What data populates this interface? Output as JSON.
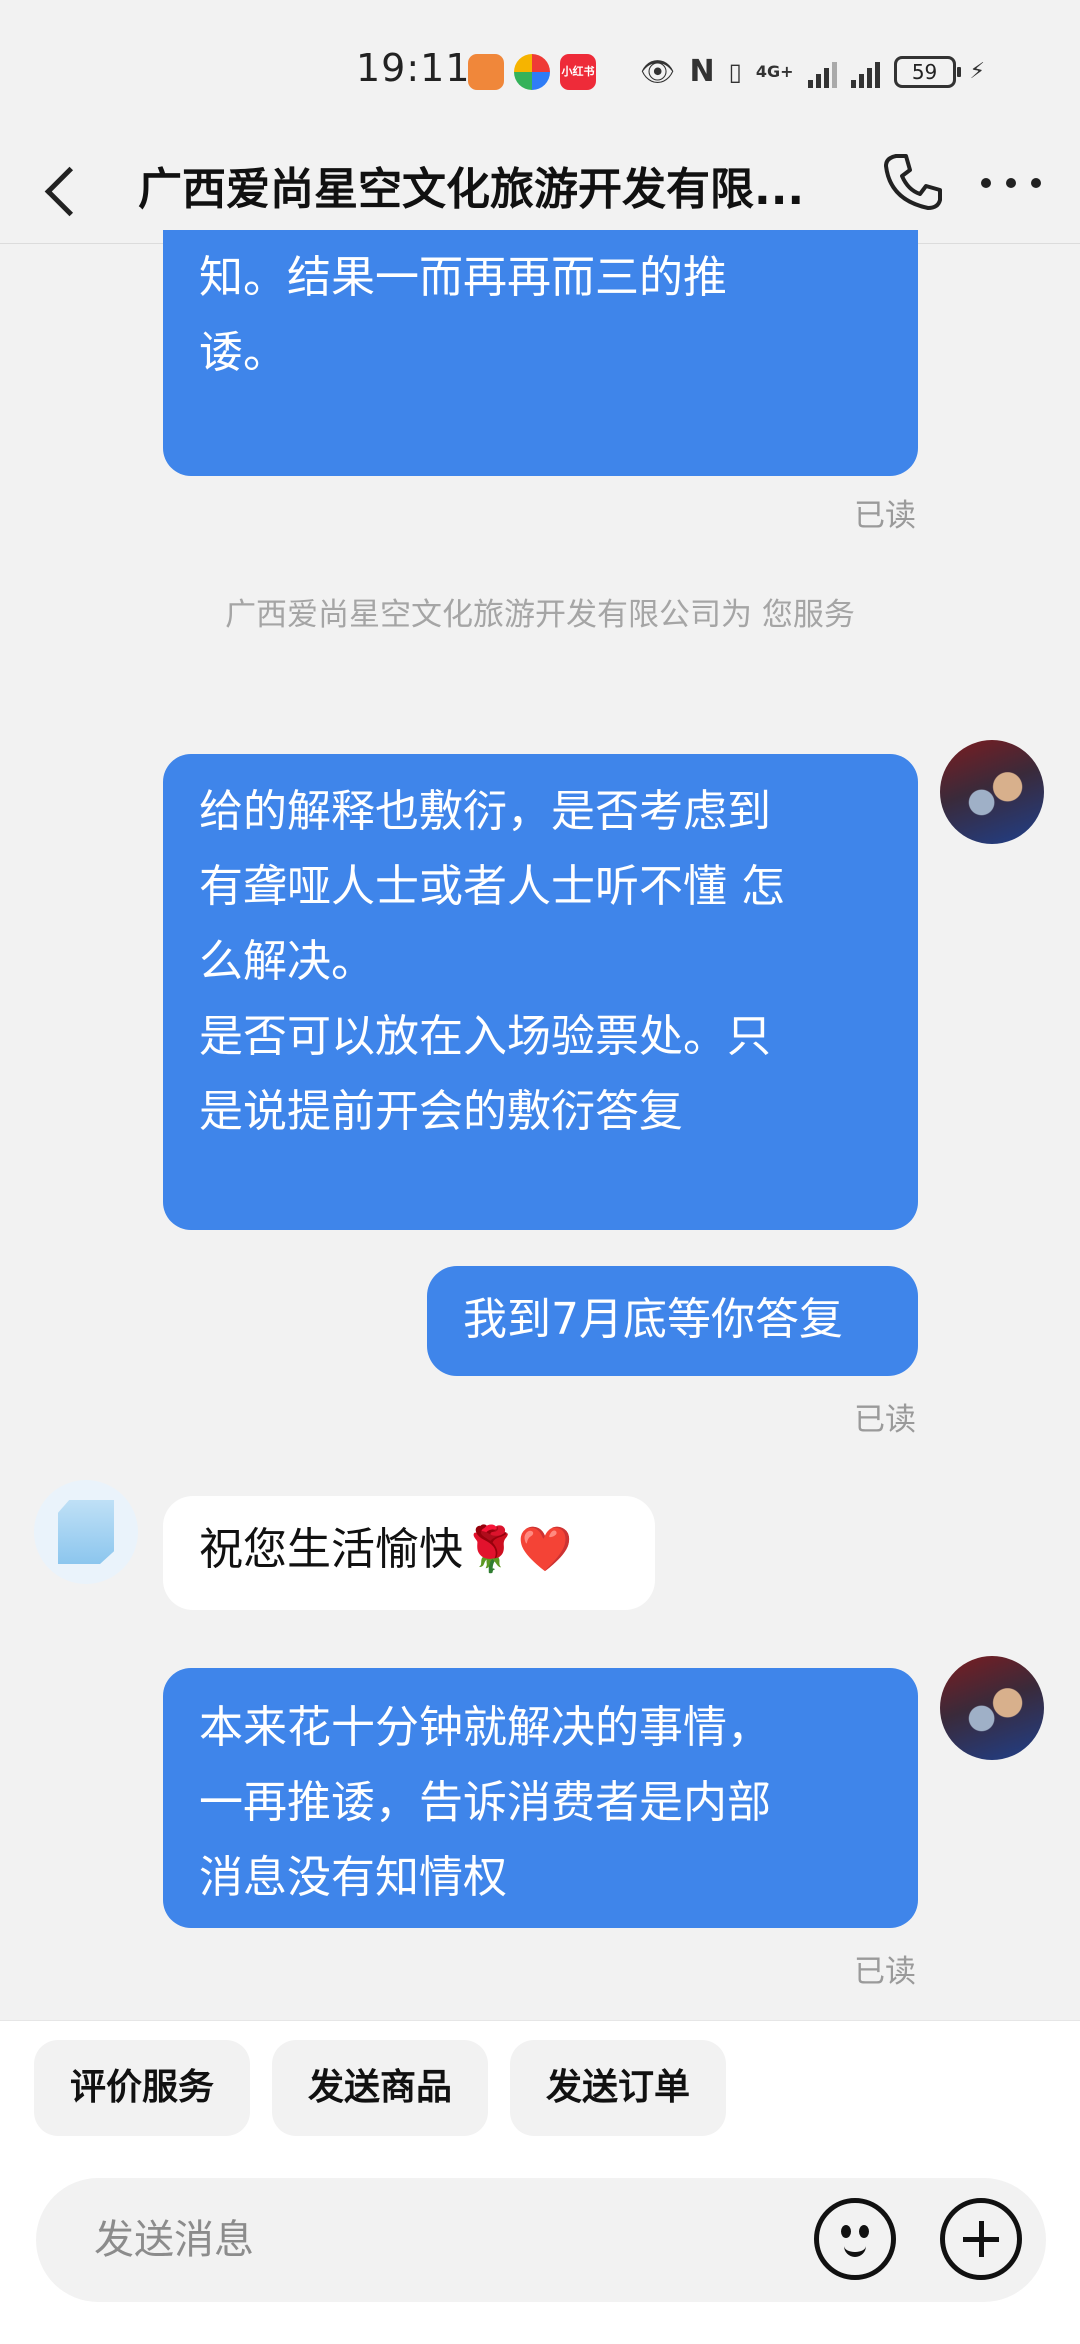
{
  "status_bar": {
    "time": "19:11",
    "app_icon_label": "小红书",
    "battery": "59",
    "network": "4G+"
  },
  "header": {
    "title": "广西爱尚星空文化旅游开发有限...",
    "back_icon": "chevron-left-icon",
    "phone_icon": "phone-icon",
    "more_icon": "more-dots-icon"
  },
  "messages": [
    {
      "side": "right",
      "text": "知。结果一而再再而三的推\n诿。",
      "status": "已读"
    },
    {
      "side": "system",
      "text": "广西爱尚星空文化旅游开发有限公司为\n您服务"
    },
    {
      "side": "right",
      "text": "给的解释也敷衍，是否考虑到\n有聋哑人士或者人士听不懂 怎\n么解决。\n是否可以放在入场验票处。只\n是说提前开会的敷衍答复"
    },
    {
      "side": "right",
      "text": "我到7月底等你答复",
      "status": "已读"
    },
    {
      "side": "left",
      "text": "祝您生活愉快🌹❤️"
    },
    {
      "side": "right",
      "text": "本来花十分钟就解决的事情，\n一再推诿，告诉消费者是内部\n消息没有知情权",
      "status": "已读"
    }
  ],
  "quick_actions": [
    "评价服务",
    "发送商品",
    "发送订单"
  ],
  "input": {
    "placeholder": "发送消息"
  },
  "colors": {
    "bubble_blue": "#3f85ea",
    "background": "#f2f2f2",
    "read_gray": "#9a9a9a"
  }
}
